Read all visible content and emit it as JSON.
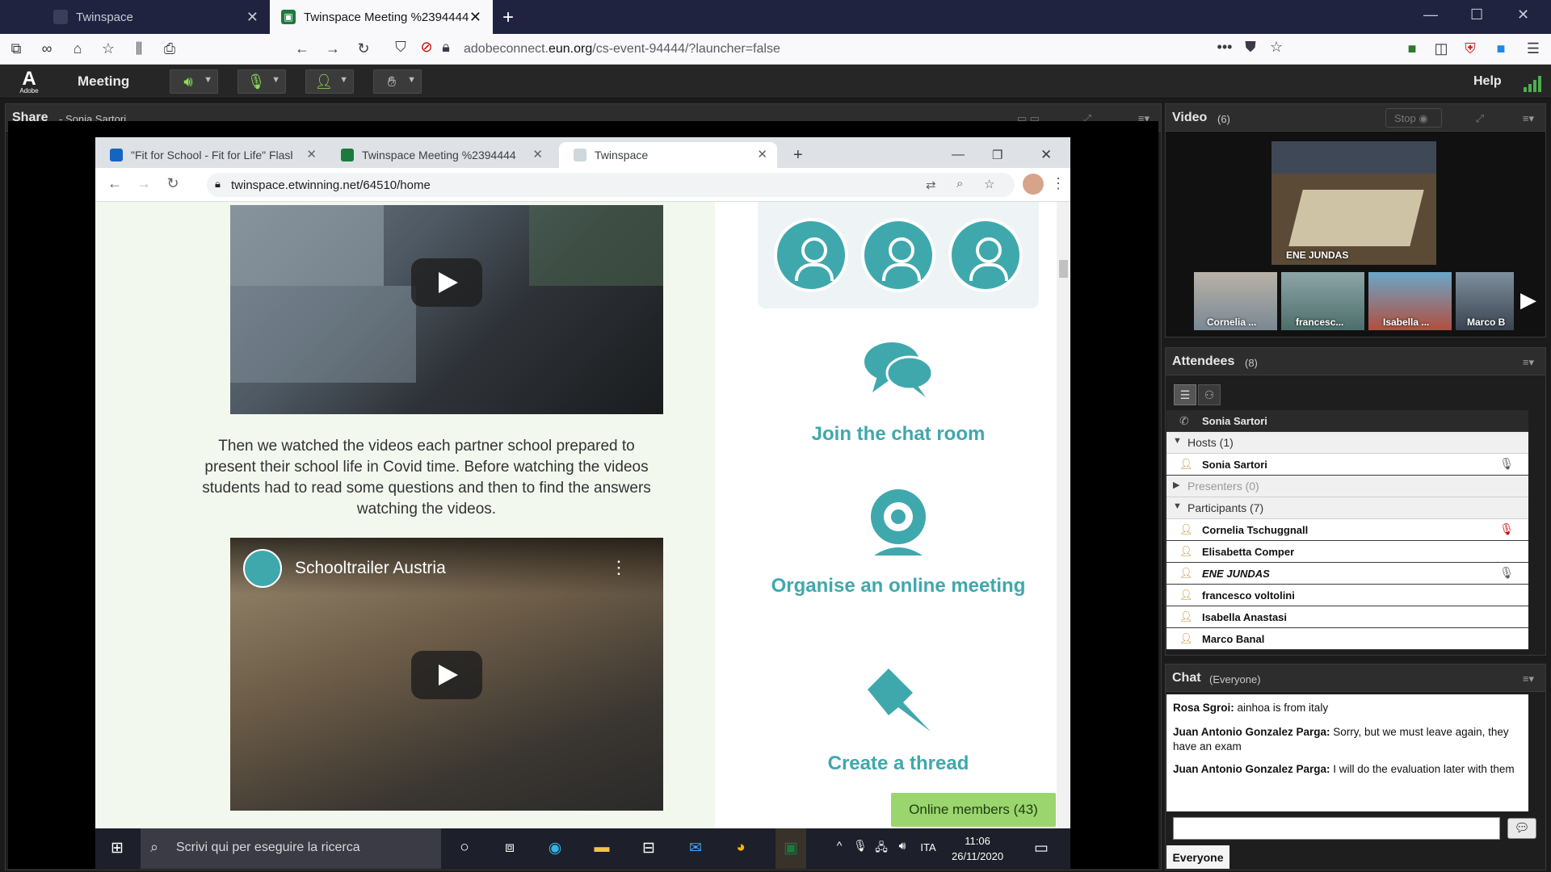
{
  "firefox": {
    "tabs": [
      {
        "label": "Twinspace",
        "active": false
      },
      {
        "label": "Twinspace Meeting %2394444",
        "active": true
      }
    ],
    "url_prefix": "adobeconnect.",
    "url_domain": "eun.org",
    "url_path": "/cs-event-94444/?launcher=false",
    "url_more": "•••"
  },
  "connect_bar": {
    "logo": "A",
    "logo_sub": "Adobe",
    "menu": "Meeting",
    "help": "Help"
  },
  "share_pod": {
    "title": "Share",
    "presenter": "- Sonia Sartori"
  },
  "chrome": {
    "tabs": [
      {
        "label": "\"Fit for School - Fit for Life\" Flash"
      },
      {
        "label": "Twinspace Meeting %2394444"
      },
      {
        "label": "Twinspace"
      }
    ],
    "url": "twinspace.etwinning.net/64510/home"
  },
  "twinspace_page": {
    "body_text": "Then we watched the videos each partner school prepared to present their school life in Covid time. Before watching the videos students had to read some questions and then to find the answers watching the videos.",
    "video2_title": "Schooltrailer Austria",
    "features": [
      {
        "label": "Join the chat room",
        "icon": "chat-icon"
      },
      {
        "label": "Organise an online meeting",
        "icon": "webcam-icon"
      },
      {
        "label": "Create a thread",
        "icon": "pin-icon"
      }
    ],
    "online_members": "Online members (43)"
  },
  "taskbar": {
    "search_placeholder": "Scrivi qui per eseguire la ricerca",
    "lang": "ITA",
    "time": "11:06",
    "date": "26/11/2020"
  },
  "video_pod": {
    "title": "Video",
    "count": "(6)",
    "stop": "Stop",
    "main_label": "ENE JUNDAS",
    "thumbs": [
      "Cornelia ...",
      "francesc...",
      "Isabella ...",
      "Marco B"
    ]
  },
  "attendees_pod": {
    "title": "Attendees",
    "count": "(8)",
    "me": "Sonia Sartori",
    "hosts_label": "Hosts (1)",
    "hosts": [
      "Sonia Sartori"
    ],
    "presenters_label": "Presenters (0)",
    "participants_label": "Participants (7)",
    "participants": [
      "Cornelia Tschuggnall",
      "Elisabetta Comper",
      "ENE JUNDAS",
      "francesco voltolini",
      "Isabella Anastasi",
      "Marco Banal"
    ]
  },
  "chat_pod": {
    "title": "Chat",
    "scope": "(Everyone)",
    "messages": [
      {
        "author": "Rosa Sgroi:",
        "text": " ainhoa is from italy"
      },
      {
        "author": "Juan Antonio Gonzalez Parga:",
        "text": " Sorry, but we must leave again, they have an exam"
      },
      {
        "author": "Juan Antonio Gonzalez Parga:",
        "text": " I will do the evaluation later with them"
      }
    ],
    "input_value": "",
    "recipient": "Everyone"
  },
  "colors": {
    "teal": "#3fa8ad",
    "green_badge": "#9bd56e",
    "pod_bg": "#1e1e1e"
  }
}
